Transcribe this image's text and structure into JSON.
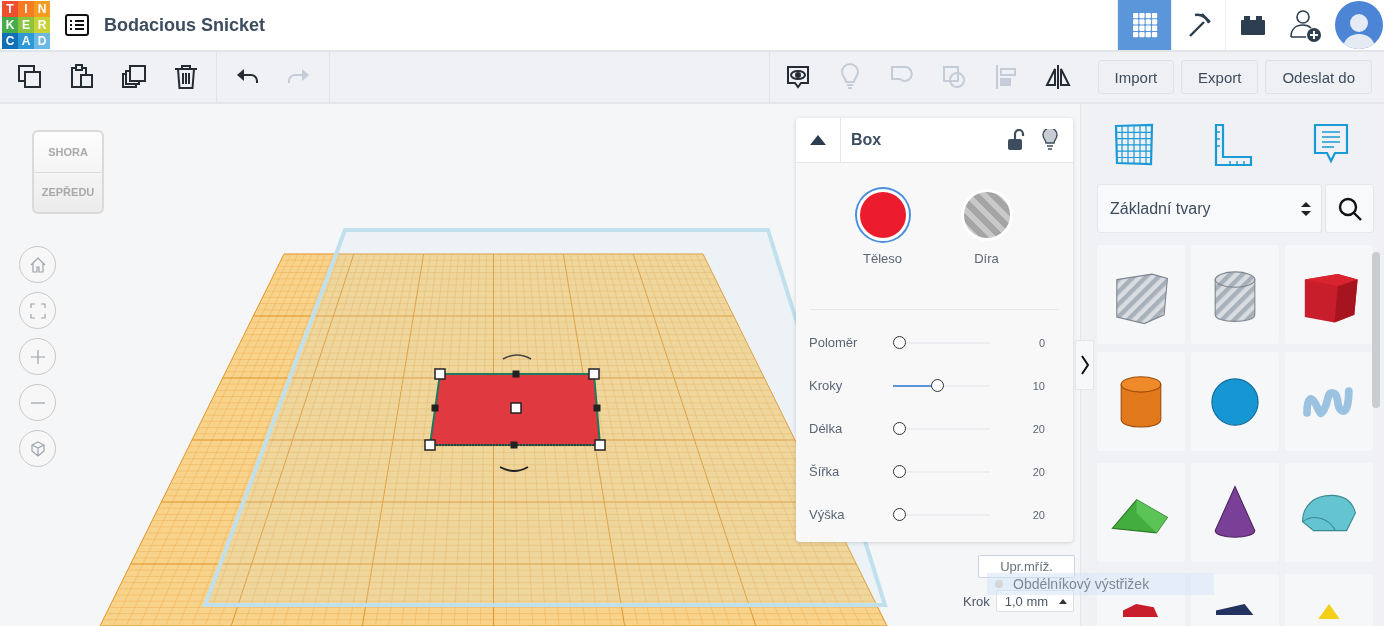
{
  "header": {
    "logo": [
      {
        "letter": "T",
        "color": "#ee4f2e"
      },
      {
        "letter": "I",
        "color": "#f57c22"
      },
      {
        "letter": "N",
        "color": "#f59d23"
      },
      {
        "letter": "K",
        "color": "#47ad4b"
      },
      {
        "letter": "E",
        "color": "#8cc43f"
      },
      {
        "letter": "R",
        "color": "#c9d235"
      },
      {
        "letter": "C",
        "color": "#1270b7"
      },
      {
        "letter": "A",
        "color": "#2e99d7"
      },
      {
        "letter": "D",
        "color": "#6cb7e3"
      }
    ],
    "title": "Bodacious Snicket",
    "view_buttons": [
      {
        "kind": "grid",
        "selected": true
      },
      {
        "kind": "pickaxe",
        "selected": false
      },
      {
        "kind": "brick",
        "selected": false
      }
    ]
  },
  "toolbar": {
    "edit_tools": [
      {
        "kind": "copy",
        "disabled": false
      },
      {
        "kind": "paste",
        "disabled": false
      },
      {
        "kind": "duplicate",
        "disabled": false
      },
      {
        "kind": "delete",
        "disabled": false
      }
    ],
    "history_tools": [
      {
        "kind": "undo",
        "disabled": false
      },
      {
        "kind": "redo",
        "disabled": true
      }
    ],
    "shape_tools": [
      {
        "kind": "notes",
        "disabled": false
      },
      {
        "kind": "bulb",
        "disabled": true
      },
      {
        "kind": "group",
        "disabled": true
      },
      {
        "kind": "ungroup",
        "disabled": true
      },
      {
        "kind": "align",
        "disabled": true
      },
      {
        "kind": "mirror",
        "disabled": false
      }
    ],
    "buttons": [
      "Import",
      "Export",
      "Odeslat do"
    ]
  },
  "view_cube": {
    "top": "SHORA",
    "front": "ZEPŘEDU"
  },
  "nav_buttons": [
    {
      "kind": "home"
    },
    {
      "kind": "fit"
    },
    {
      "kind": "zoom-in"
    },
    {
      "kind": "zoom-out"
    },
    {
      "kind": "perspective"
    }
  ],
  "inspector": {
    "title": "Box",
    "locked": false,
    "modes": [
      {
        "label": "Těleso",
        "kind": "solid",
        "selected": true,
        "color": "#ec1c2e"
      },
      {
        "label": "Díra",
        "kind": "hole",
        "selected": false
      }
    ],
    "sliders": [
      {
        "label": "Poloměr",
        "level": 0,
        "value": "0"
      },
      {
        "label": "Kroky",
        "level": 0.45,
        "value": "10"
      },
      {
        "label": "Délka",
        "level": 0,
        "value": "20"
      },
      {
        "label": "Šířka",
        "level": 0,
        "value": "20"
      },
      {
        "label": "Výška",
        "level": 0,
        "value": "20"
      }
    ]
  },
  "grid_controls": {
    "edit_grid": "Upr.mříž.",
    "snap_label": "Krok",
    "snap_value": "1,0 mm"
  },
  "drag_label": "Obdélníkový výstřižek",
  "library": {
    "tools": [
      {
        "kind": "workplane"
      },
      {
        "kind": "ruler"
      },
      {
        "kind": "notes"
      }
    ],
    "category": "Základní tvary",
    "shapes": [
      {
        "kind": "box-hole"
      },
      {
        "kind": "cylinder-hole"
      },
      {
        "kind": "box"
      },
      {
        "kind": "cylinder"
      },
      {
        "kind": "sphere"
      },
      {
        "kind": "scribble"
      },
      {
        "kind": "roof"
      },
      {
        "kind": "cone"
      },
      {
        "kind": "round-roof"
      },
      {
        "kind": "text"
      },
      {
        "kind": "wedge"
      },
      {
        "kind": "pyramid"
      }
    ]
  }
}
